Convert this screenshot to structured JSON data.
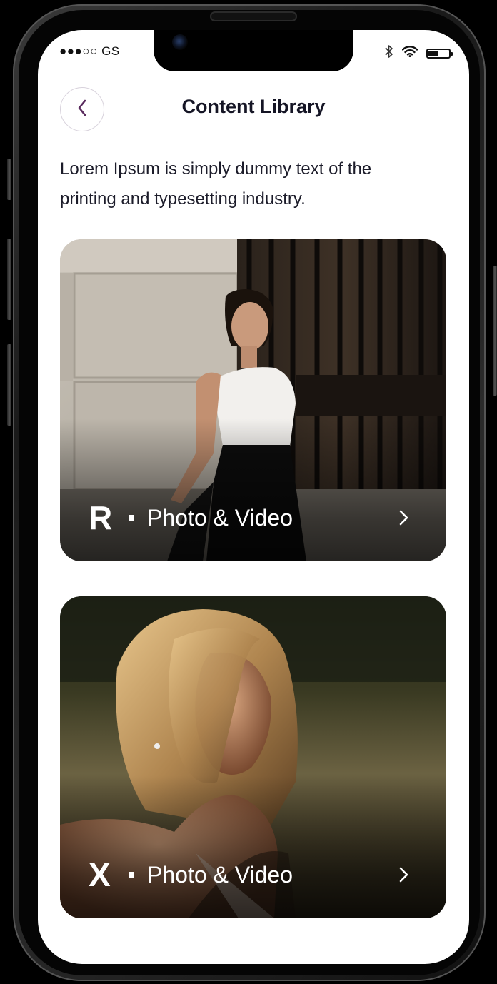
{
  "status_bar": {
    "carrier": "●●●○○ GS",
    "battery_level": 0.5
  },
  "header": {
    "back_icon": "chevron-left-icon",
    "title": "Content Library"
  },
  "description": "Lorem Ipsum is simply dummy text of the printing and typesetting industry.",
  "cards": [
    {
      "letter": "R",
      "label": "Photo & Video",
      "icon": "chevron-right-icon"
    },
    {
      "letter": "X",
      "label": "Photo & Video",
      "icon": "chevron-right-icon"
    }
  ],
  "colors": {
    "accent": "#5a2b5e",
    "text": "#151525",
    "background": "#ffffff"
  }
}
